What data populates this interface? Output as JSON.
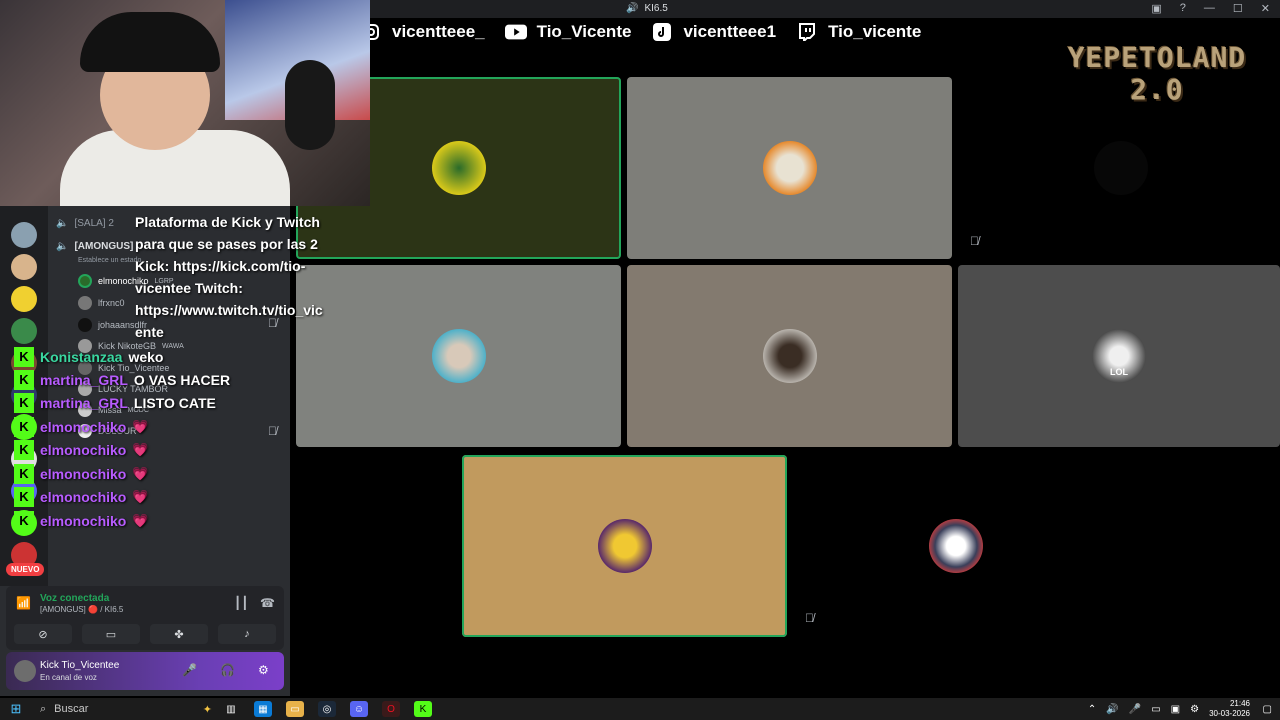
{
  "titlebar": {
    "channel": "KI6.5"
  },
  "socials": {
    "instagram": "vicentteee_",
    "youtube": "Tio_Vicente",
    "tiktok": "vicentteee1",
    "twitch": "Tio_vicente"
  },
  "logo": {
    "line1": "YEPETOLAND",
    "line2": "2.0"
  },
  "sidebar": {
    "channels": [
      {
        "label": "[SALA] 2"
      },
      {
        "label": "[AMONGUS]"
      },
      {
        "label": "Establece un estado"
      }
    ],
    "members": [
      {
        "name": "elmonochiko",
        "tag": "LGRP"
      },
      {
        "name": "lfrxnc0",
        "tag": ""
      },
      {
        "name": "johaaansdlfr",
        "tag": ""
      },
      {
        "name": "Kick NikoteGB",
        "tag": "WAWA"
      },
      {
        "name": "Kick Tio_Vicentee",
        "tag": ""
      },
      {
        "name": "LUCKY TAMBOR",
        "tag": ""
      },
      {
        "name": "Missa",
        "tag": "MODC"
      },
      {
        "name": "DOLOUR",
        "tag": ""
      }
    ],
    "nuevo_badge": "NUEVO",
    "voice": {
      "status": "Voz conectada",
      "channel": "[AMONGUS] 🔴 / KI6.5"
    },
    "user": {
      "name": "Kick Tio_Vicentee",
      "status": "En canal de voz"
    }
  },
  "chat": {
    "system_message": "Plataforma de Kick y Twitch\npara que se pases por las 2\nKick: https://kick.com/tio-\nvicentee Twitch:\nhttps://www.twitch.tv/tio_vic\nente",
    "messages": [
      {
        "name": "Konistanzaa",
        "text": "weko"
      },
      {
        "name": "martina_GRL",
        "text": "O VAS HACER"
      },
      {
        "name": "martina_GRL",
        "text": "LISTO CATE"
      },
      {
        "name": "elmonochiko",
        "text": ""
      },
      {
        "name": "elmonochiko",
        "text": ""
      },
      {
        "name": "elmonochiko",
        "text": ""
      },
      {
        "name": "elmonochiko",
        "text": ""
      },
      {
        "name": "elmonochiko",
        "text": ""
      }
    ]
  },
  "tiles": [
    {
      "bg": "#2c3416",
      "speaking": true
    },
    {
      "bg": "#7e7e79",
      "speaking": false
    },
    {
      "bg": "#000000",
      "speaking": false
    },
    {
      "bg": "#80827e",
      "speaking": false
    },
    {
      "bg": "#837a6f",
      "speaking": false
    },
    {
      "bg": "#4d4d4d",
      "speaking": false,
      "avatar_text": "LOL"
    },
    {
      "bg": "#c19a5e",
      "speaking": true
    },
    {
      "bg": "#000000",
      "speaking": false
    }
  ],
  "taskbar": {
    "search_label": "Buscar",
    "time": "21:46",
    "date": "30-03-2026"
  },
  "colors": {
    "discord_green": "#23a55a",
    "kick_green": "#53fc18",
    "chat_name_purple": "#b85cff"
  }
}
